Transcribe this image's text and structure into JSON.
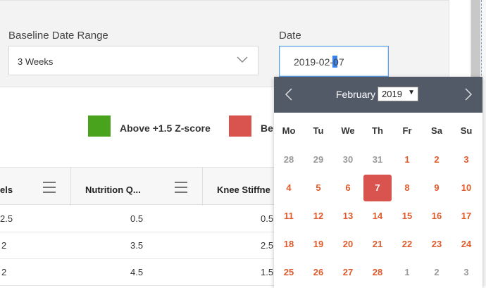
{
  "filters": {
    "baseline_label": "Baseline Date Range",
    "baseline_value": "3 Weeks",
    "date_label": "Date",
    "date_value": "2019-02-07"
  },
  "legend": [
    {
      "label": "Above +1.5 Z-score",
      "color": "#4aa31c"
    },
    {
      "label": "Be",
      "color": "#d9534f"
    }
  ],
  "table": {
    "headers": [
      "els",
      "Nutrition Q...",
      "Knee Stiffne"
    ],
    "rows": [
      [
        "2.5",
        "0.5",
        "0.5"
      ],
      [
        "2",
        "3.5",
        "2.5"
      ],
      [
        "2",
        "4.5",
        "1.5"
      ]
    ]
  },
  "calendar": {
    "month": "February",
    "year": "2019",
    "weekdays": [
      "Mo",
      "Tu",
      "We",
      "Th",
      "Fr",
      "Sa",
      "Su"
    ],
    "weeks": [
      [
        "28",
        "29",
        "30",
        "31",
        "1",
        "2",
        "3"
      ],
      [
        "4",
        "5",
        "6",
        "7",
        "8",
        "9",
        "10"
      ],
      [
        "11",
        "12",
        "13",
        "14",
        "15",
        "16",
        "17"
      ],
      [
        "18",
        "19",
        "20",
        "21",
        "22",
        "23",
        "24"
      ],
      [
        "25",
        "26",
        "27",
        "28",
        "1",
        "2",
        "3"
      ]
    ],
    "selected_day": "7",
    "colors": {
      "header": "#525a68",
      "in_month": "#e05a2b",
      "selected": "#d9534f"
    }
  }
}
